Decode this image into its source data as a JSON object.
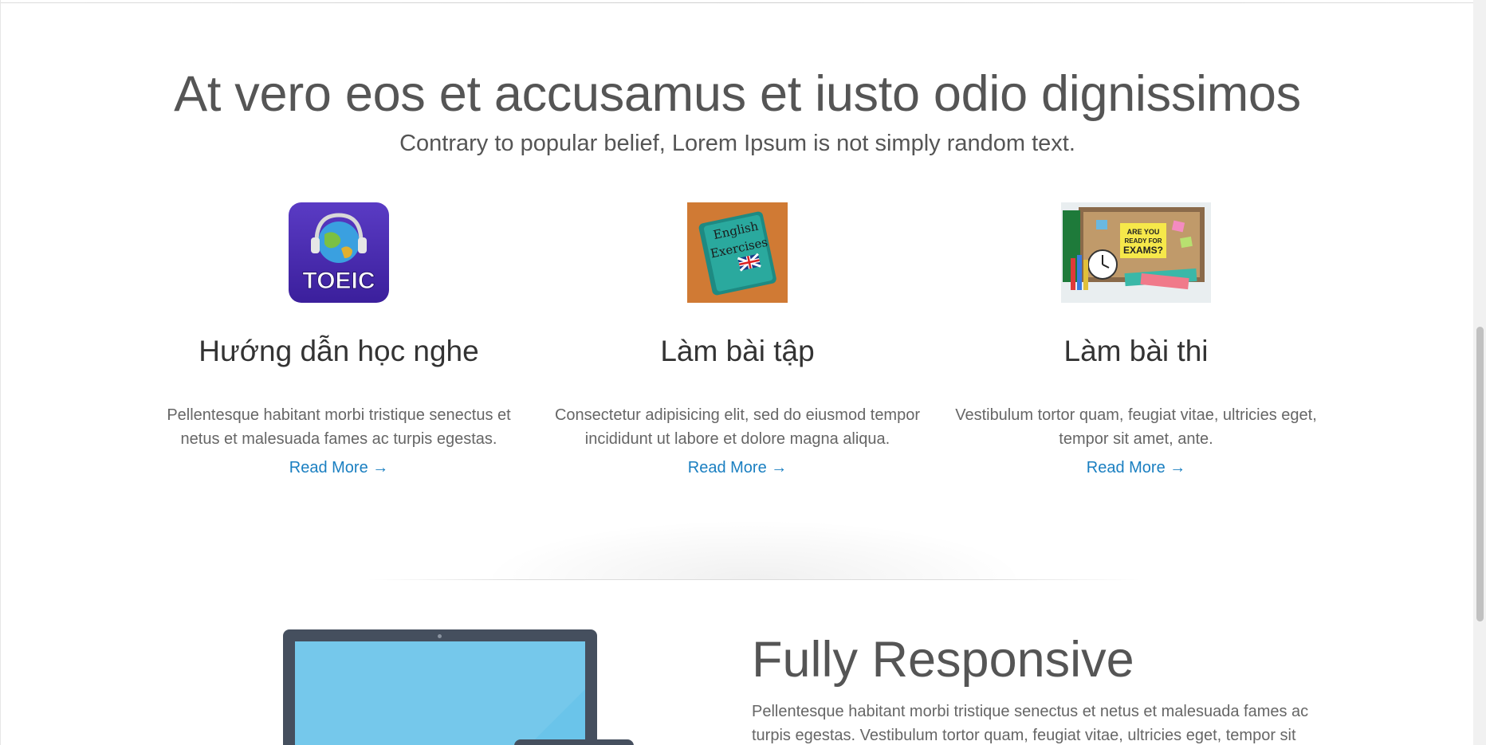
{
  "hero": {
    "title": "At vero eos et accusamus et iusto odio dignissimos",
    "subtitle": "Contrary to popular belief, Lorem Ipsum is not simply random text."
  },
  "features": [
    {
      "image_label": "TOEIC",
      "title": "Hướng dẫn học nghe",
      "text": "Pellentesque habitant morbi tristique senectus et netus et malesuada fames ac turpis egestas.",
      "link": "Read More →"
    },
    {
      "image_label": "English Exercises",
      "title": "Làm bài tập",
      "text": "Consectetur adipisicing elit, sed do eiusmod tempor incididunt ut labore et dolore magna aliqua.",
      "link": "Read More →"
    },
    {
      "image_label": "ARE YOU READY FOR EXAMS?",
      "title": "Làm bài thi",
      "text": "Vestibulum tortor quam, feugiat vitae, ultricies eget, tempor sit amet, ante.",
      "link": "Read More →"
    }
  ],
  "responsive": {
    "title": "Fully Responsive",
    "body": "Pellentesque habitant morbi tristique senectus et netus et malesuada fames ac turpis egestas. Vestibulum tortor quam, feugiat vitae, ultricies eget, tempor sit"
  },
  "colors": {
    "link": "#1a7fc1",
    "heading": "#555555",
    "laptop_frame": "#454f5e",
    "laptop_screen": "#6ac4ea"
  }
}
